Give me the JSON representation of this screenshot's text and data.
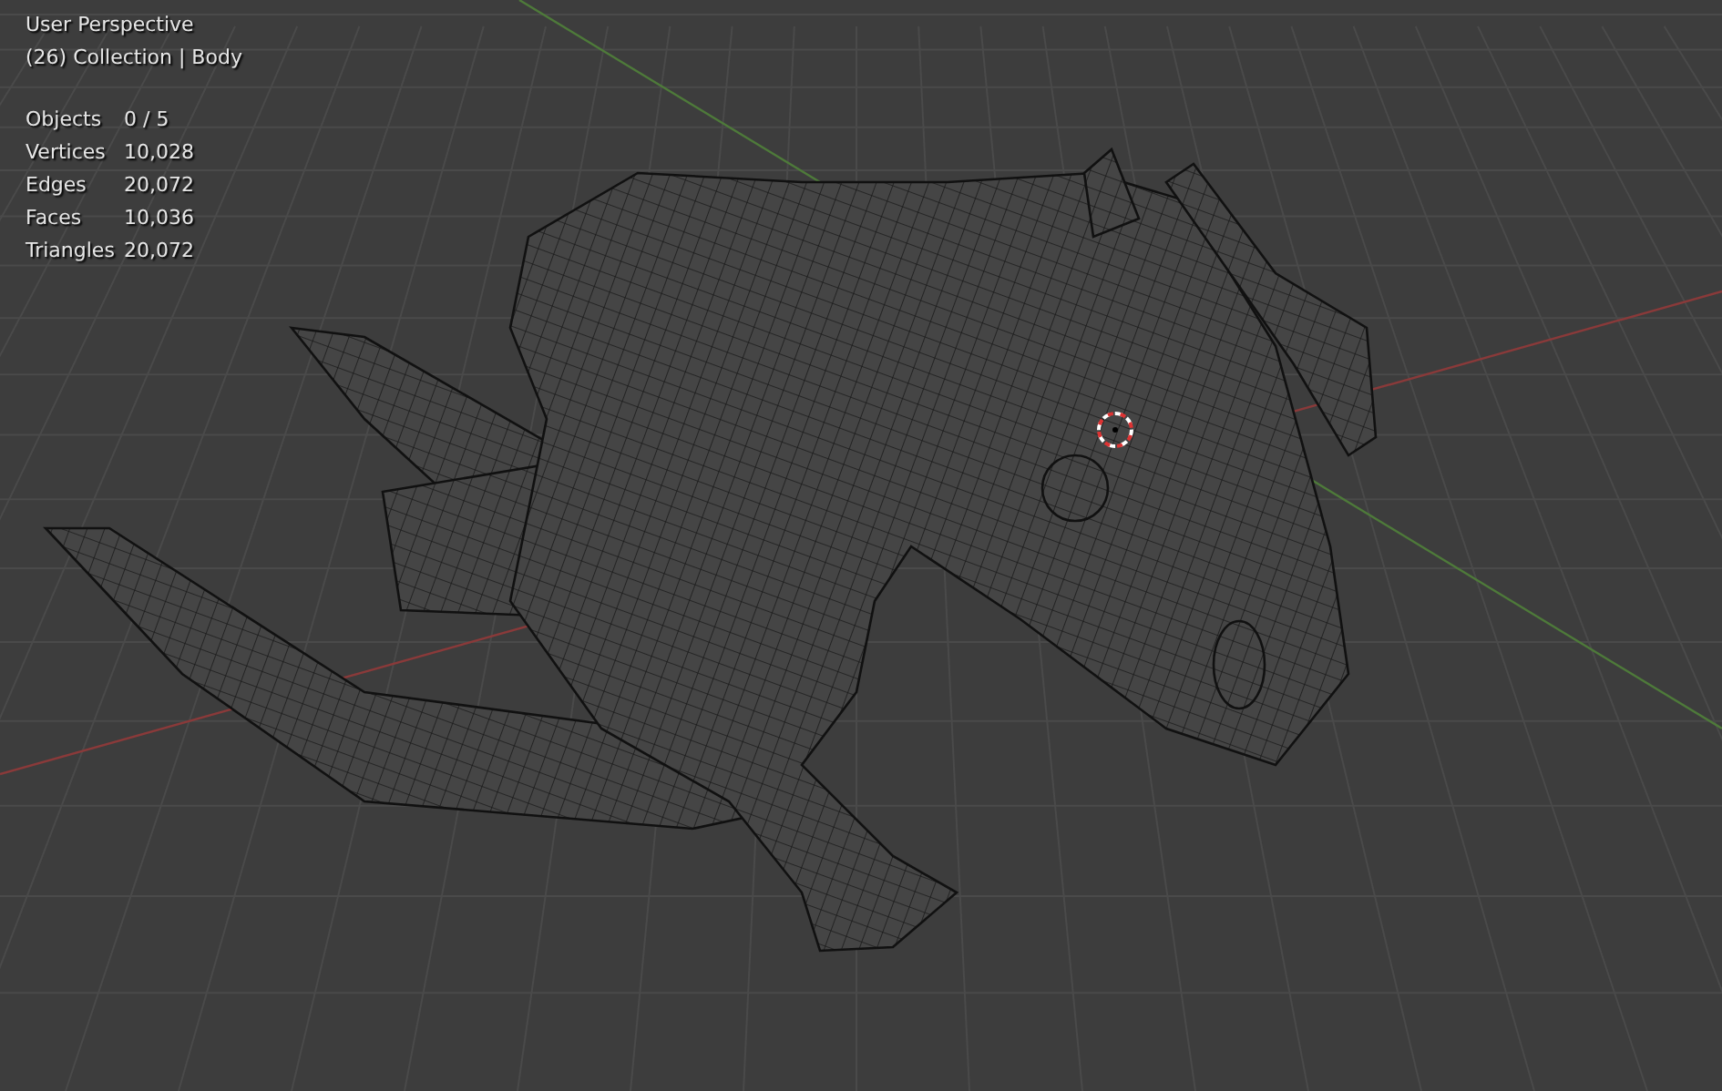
{
  "viewport": {
    "view_name": "User Perspective",
    "collection_info": "(26) Collection | Body",
    "stats": [
      {
        "label": "Objects",
        "value": "0 / 5"
      },
      {
        "label": "Vertices",
        "value": "10,028"
      },
      {
        "label": "Edges",
        "value": "20,072"
      },
      {
        "label": "Faces",
        "value": "10,036"
      },
      {
        "label": "Triangles",
        "value": "20,072"
      }
    ]
  }
}
